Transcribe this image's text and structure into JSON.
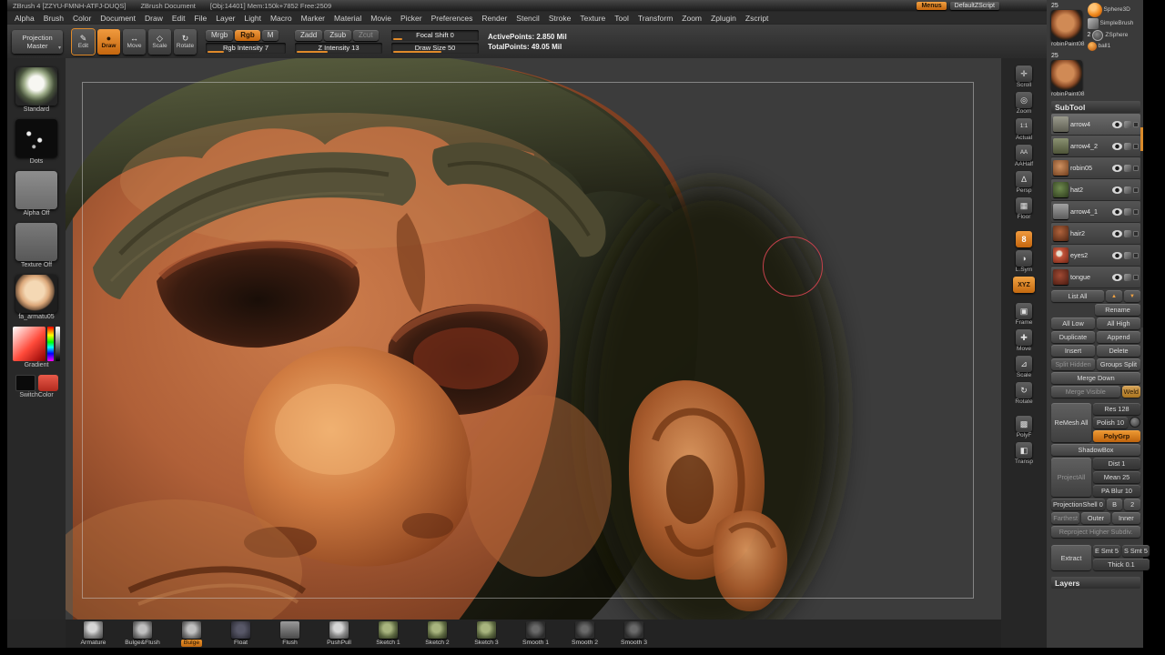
{
  "titlebar": {
    "app": "ZBrush 4 [ZZYU-FMNH-ATFJ-DUQS]",
    "document": "ZBrush Document",
    "stats": "[Obj:14401] Mem:150k+7852 Free:2509",
    "menus": "Menus",
    "zscript": "DefaultZScript"
  },
  "menubar": {
    "items": [
      "Alpha",
      "Brush",
      "Color",
      "Document",
      "Draw",
      "Edit",
      "File",
      "Layer",
      "Light",
      "Macro",
      "Marker",
      "Material",
      "Movie",
      "Picker",
      "Preferences",
      "Render",
      "Stencil",
      "Stroke",
      "Texture",
      "Tool",
      "Transform",
      "Zoom",
      "Zplugin",
      "Zscript"
    ]
  },
  "toolbar": {
    "projection_master": "Projection Master",
    "edit": "Edit",
    "draw": "Draw",
    "move": "Move",
    "scale": "Scale",
    "rotate": "Rotate",
    "mrgb": "Mrgb",
    "rgb": "Rgb",
    "m": "M",
    "rgb_intensity": "Rgb Intensity 7",
    "zadd": "Zadd",
    "zsub": "Zsub",
    "zcut": "Zcut",
    "z_intensity": "Z Intensity 13",
    "focal_shift": "Focal Shift 0",
    "draw_size": "Draw Size 50",
    "active_points": "ActivePoints: 2.850 Mil",
    "total_points": "TotalPoints: 49.05 Mil"
  },
  "left_panel": {
    "standard": "Standard",
    "dots": "Dots",
    "alpha_off": "Alpha Off",
    "texture_off": "Texture  Off",
    "material": "fa_armatu05",
    "gradient": "Gradient",
    "switch_color": "SwitchColor"
  },
  "icons": {
    "caret": "▾",
    "edit": "✎",
    "draw": "●",
    "move_mode": "↔",
    "scale_mode": "◇",
    "rotate_mode": "↻",
    "scroll": "✛",
    "zoom": "◎",
    "actual": "1:1",
    "aahalf": "AA",
    "persp": "∆",
    "floor": "▦",
    "active_tool": "8",
    "lsym": "◑",
    "xyz": "XYZ",
    "frame": "▣",
    "move": "✚",
    "scale": "⊿",
    "rotate": "↻",
    "polyf": "▩",
    "transp": "◧",
    "up": "▲",
    "down": "▼"
  },
  "right_strip": {
    "items": [
      "Scroll",
      "Zoom",
      "Actual",
      "AAHalf",
      "Persp",
      "Floor",
      "L.Sym",
      "Frame",
      "Move",
      "Scale",
      "Rotate",
      "PolyF",
      "Transp"
    ]
  },
  "tool_palette": {
    "badge_top": "25",
    "badge_mid": "2",
    "badge_bottom": "25",
    "tool1": "robinPaint08",
    "sphere3d": "Sphere3D",
    "simplebrush": "SimpleBrush",
    "zsphere": "ZSphere",
    "ball1": "ball1",
    "tool2": "robinPaint08"
  },
  "subtool": {
    "header": "SubTool",
    "items": [
      {
        "name": "arrow4"
      },
      {
        "name": "arrow4_2"
      },
      {
        "name": "robin05"
      },
      {
        "name": "hat2"
      },
      {
        "name": "arrow4_1"
      },
      {
        "name": "hair2"
      },
      {
        "name": "eyes2"
      },
      {
        "name": "tongue"
      }
    ],
    "list_all": "List All",
    "rename": "Rename",
    "all_low": "All Low",
    "all_high": "All High",
    "duplicate": "Duplicate",
    "append": "Append",
    "insert": "Insert",
    "delete": "Delete",
    "split_hidden": "Split Hidden",
    "groups_split": "Groups Split",
    "merge_down": "Merge Down",
    "merge_visible": "Merge Visible",
    "weld": "Weld",
    "remesh_all": "ReMesh All",
    "res": "Res 128",
    "polish": "Polish 10",
    "polygrp": "PolyGrp",
    "shadowbox": "ShadowBox",
    "project_all": "ProjectAll",
    "dist": "Dist 1",
    "mean": "Mean 25",
    "pa_blur": "PA Blur 10",
    "projection_shell": "ProjectionShell 0",
    "ps_b": "B",
    "ps_2": "2",
    "farthest": "Farthest",
    "outer": "Outer",
    "inner": "Inner",
    "reproject": "Reproject Higher Subdiv.",
    "extract": "Extract",
    "e_smt": "E Smt 5",
    "s_smt": "S Smt 5",
    "thick": "Thick 0.1",
    "layers": "Layers"
  },
  "bottom_bar": {
    "items": [
      "Armature",
      "Bulge&Flush",
      "Bulge",
      "Float",
      "Flush",
      "PushPull",
      "Sketch 1",
      "Sketch 2",
      "Sketch 3",
      "Smooth 1",
      "Smooth 2",
      "Smooth 3"
    ]
  },
  "colors": {
    "accent": "#e08a2a",
    "cursor": "#c5414b"
  }
}
